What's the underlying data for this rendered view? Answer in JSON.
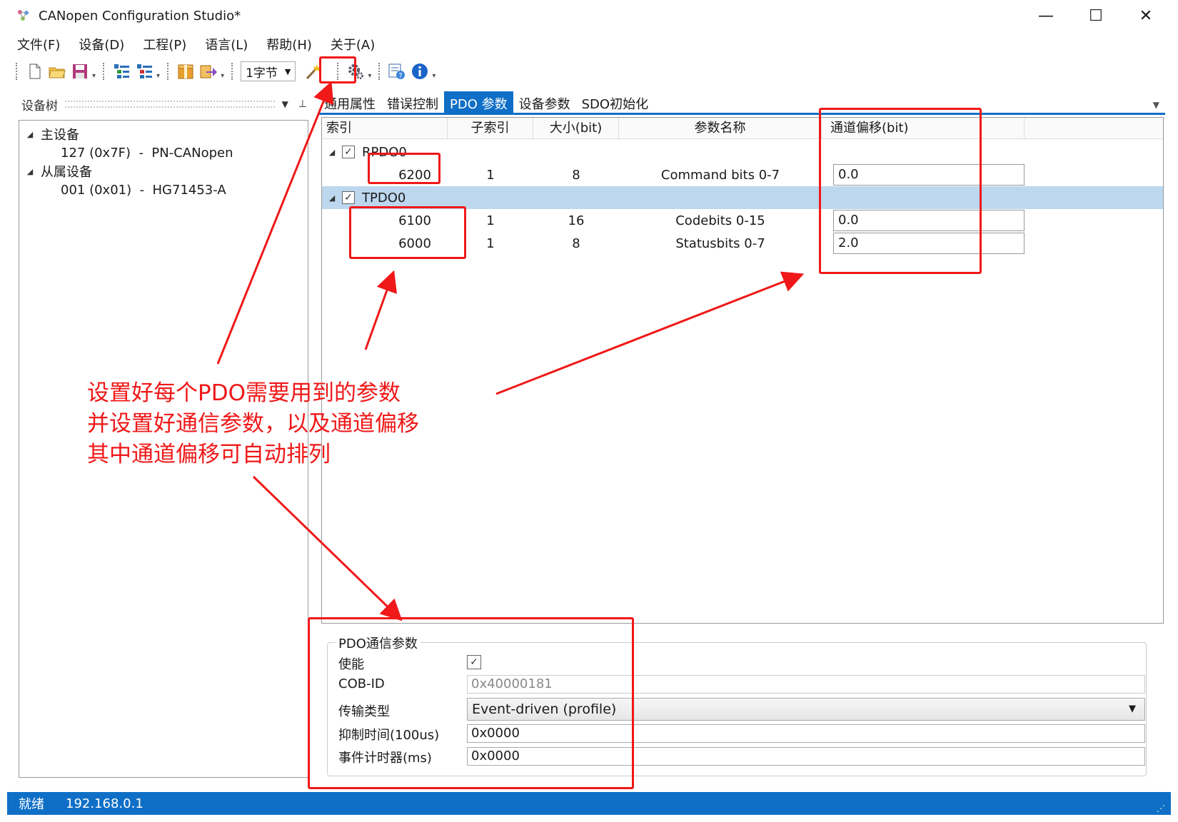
{
  "window": {
    "title": "CANopen Configuration Studio*",
    "controls": {
      "minimize": "—",
      "maximize": "☐",
      "close": "✕"
    }
  },
  "menu": [
    "文件(F)",
    "设备(D)",
    "工程(P)",
    "语言(L)",
    "帮助(H)",
    "关于(A)"
  ],
  "toolbar": {
    "byte_combo": "1字节",
    "icons": [
      "new-file-icon",
      "open-folder-icon",
      "save-icon",
      "add-module-icon",
      "remove-module-icon",
      "package-icon",
      "export-icon",
      "auto-arrange-wand-icon",
      "settings-gear-icon",
      "device-info-icon",
      "info-icon"
    ]
  },
  "device_tree": {
    "title": "设备树",
    "pin": "📌",
    "master_label": "主设备",
    "master_node": "127 (0x7F)  -  PN-CANopen",
    "slave_label": "从属设备",
    "slave_node": "001 (0x01)  -  HG71453-A"
  },
  "tabs": [
    "通用属性",
    "错误控制",
    "PDO 参数",
    "设备参数",
    "SDO初始化"
  ],
  "active_tab": "PDO 参数",
  "grid": {
    "columns": [
      "索引",
      "子索引",
      "大小(bit)",
      "参数名称",
      "通道偏移(bit)"
    ],
    "groups": [
      {
        "name": "RPDO0",
        "checked": true,
        "rows": [
          {
            "index": "6200",
            "subindex": "1",
            "size": "8",
            "name": "Command bits 0-7",
            "offset": "0.0"
          }
        ]
      },
      {
        "name": "TPDO0",
        "checked": true,
        "selected": true,
        "rows": [
          {
            "index": "6100",
            "subindex": "1",
            "size": "16",
            "name": "Codebits 0-15",
            "offset": "0.0"
          },
          {
            "index": "6000",
            "subindex": "1",
            "size": "8",
            "name": "Statusbits 0-7",
            "offset": "2.0"
          }
        ]
      }
    ]
  },
  "pdo_comm": {
    "legend": "PDO通信参数",
    "enable_label": "使能",
    "enable_checked": true,
    "cobid_label": "COB-ID",
    "cobid_value": "0x40000181",
    "transmission_label": "传输类型",
    "transmission_value": "Event-driven (profile)",
    "inhibit_label": "抑制时间(100us)",
    "inhibit_value": "0x0000",
    "event_timer_label": "事件计时器(ms)",
    "event_timer_value": "0x0000"
  },
  "status": {
    "state": "就绪",
    "ip": "192.168.0.1"
  },
  "annotation": {
    "lines": [
      "设置好每个PDO需要用到的参数",
      "并设置好通信参数，以及通道偏移",
      "其中通道偏移可自动排列"
    ],
    "color": "#f01818"
  },
  "colors": {
    "accent": "#0f6fc6",
    "selection": "#bcd7ee",
    "annotation": "#f01818"
  }
}
